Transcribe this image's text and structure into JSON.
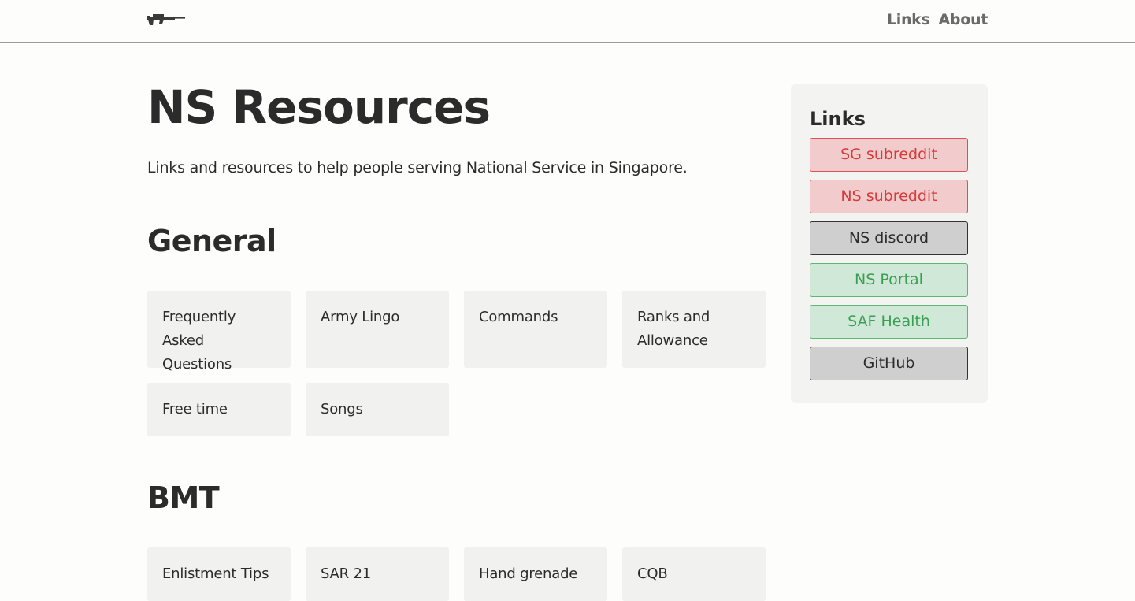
{
  "header": {
    "logo_icon": "rifle-icon",
    "nav": [
      {
        "label": "Links"
      },
      {
        "label": "About"
      }
    ]
  },
  "main": {
    "title": "NS Resources",
    "intro": "Links and resources to help people serving National Service in Singapore.",
    "sections": [
      {
        "heading": "General",
        "cards": [
          {
            "label": "Frequently Asked Questions"
          },
          {
            "label": "Army Lingo"
          },
          {
            "label": "Commands"
          },
          {
            "label": "Ranks and Allowance"
          },
          {
            "label": "Free time"
          },
          {
            "label": "Songs"
          }
        ]
      },
      {
        "heading": "BMT",
        "cards": [
          {
            "label": "Enlistment Tips"
          },
          {
            "label": "SAR 21"
          },
          {
            "label": "Hand grenade"
          },
          {
            "label": "CQB"
          }
        ]
      }
    ]
  },
  "sidebar": {
    "heading": "Links",
    "links": [
      {
        "label": "SG subreddit",
        "style": "red"
      },
      {
        "label": "NS subreddit",
        "style": "red"
      },
      {
        "label": "NS discord",
        "style": "grey"
      },
      {
        "label": "NS Portal",
        "style": "green"
      },
      {
        "label": "SAF Health",
        "style": "green"
      },
      {
        "label": "GitHub",
        "style": "grey"
      }
    ]
  },
  "colors": {
    "background": "#fdfdfb",
    "card": "#f1f1f0",
    "red_text": "#d63a3a",
    "red_bg": "#f2cccc",
    "green_text": "#3b9f52",
    "green_bg": "#cfe8d7",
    "grey_bg": "#cfcfcf"
  }
}
